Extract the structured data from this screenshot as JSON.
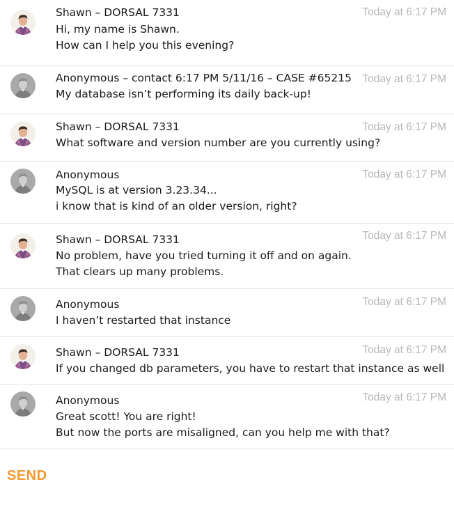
{
  "messages": [
    {
      "sender": "Shawn – DORSAL 7331",
      "time": "Today at 6:17 PM",
      "avatar": "agent",
      "lines": [
        "Hi, my name is Shawn.",
        "How can I help you this evening?"
      ]
    },
    {
      "sender": "Anonymous – contact 6:17 PM 5/11/16 – CASE #65215",
      "time": "Today at 6:17 PM",
      "avatar": "anonymous",
      "lines": [
        "My database isn’t performing its daily back-up!"
      ]
    },
    {
      "sender": "Shawn – DORSAL 7331",
      "time": "Today at 6:17 PM",
      "avatar": "agent",
      "lines": [
        "What software and version number are you currently using?"
      ]
    },
    {
      "sender": "Anonymous",
      "time": "Today at 6:17 PM",
      "avatar": "anonymous",
      "lines": [
        "MySQL is at version 3.23.34...",
        "i know that is kind of an older version, right?"
      ]
    },
    {
      "sender": "Shawn – DORSAL 7331",
      "time": "Today at 6:17 PM",
      "avatar": "agent",
      "lines": [
        "No problem, have you tried turning it off and on again.",
        "That clears up many problems."
      ]
    },
    {
      "sender": "Anonymous",
      "time": "Today at 6:17 PM",
      "avatar": "anonymous",
      "lines": [
        "I haven’t restarted that instance"
      ]
    },
    {
      "sender": "Shawn – DORSAL 7331",
      "time": "Today at 6:17 PM",
      "avatar": "agent",
      "lines": [
        "If you changed db parameters, you have to restart that instance as well"
      ]
    },
    {
      "sender": "Anonymous",
      "time": "Today at 6:17 PM",
      "avatar": "anonymous",
      "lines": [
        "Great scott!  You are right!",
        "But now the ports are misaligned, can you help me with that?"
      ]
    }
  ],
  "composer": {
    "send_label": "SEND"
  },
  "colors": {
    "accent": "#f39a33",
    "timestamp": "#b7b7b7",
    "divider": "#e3e3e3",
    "text": "#1a1a1a"
  }
}
